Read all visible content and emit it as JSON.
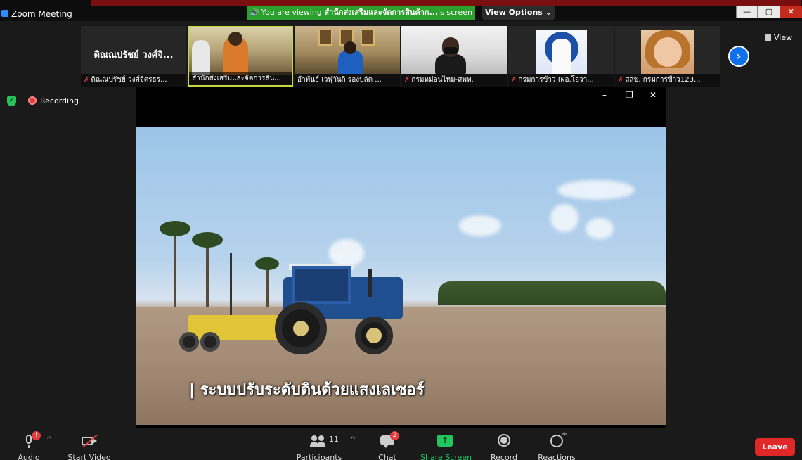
{
  "window": {
    "title": "Zoom Meeting",
    "controls": {
      "minimize": "—",
      "maximize": "▢",
      "close": "✕"
    }
  },
  "banner": {
    "prefix": "You are viewing",
    "presenter": "สำนักส่งเสริมและจัดการสินค้าก...",
    "suffix": "'s screen",
    "view_options": "View Options ⌄",
    "color": "#2ca02c"
  },
  "participants": [
    {
      "name": "ติณณปรัชย์ วงศ์จิตรธร...",
      "center_name": "ติณณปรัชย์ วงศ์จิ...",
      "muted": true,
      "video": false,
      "active": false
    },
    {
      "name": "สำนักส่งเสริมและจัดการสิน...",
      "muted": false,
      "video": true,
      "active": true
    },
    {
      "name": "อำพันธ์ เวฬุวันกิ รองปลัด ...",
      "muted": false,
      "video": true,
      "active": false
    },
    {
      "name": "กรมหม่อนไหม-สพท.",
      "muted": true,
      "video": true,
      "active": false
    },
    {
      "name": "กรมการข้าว (ผอ.โอวา...",
      "muted": true,
      "video": true,
      "active": false
    },
    {
      "name": "สสข. กรมการข้าว123...",
      "muted": true,
      "video": true,
      "active": false
    }
  ],
  "strip_controls": {
    "next_arrow": "›",
    "view_label": "View"
  },
  "recording": {
    "label": "Recording",
    "shield": "✓"
  },
  "share_controls": {
    "minimize": "–",
    "restore": "❐",
    "close": "✕"
  },
  "video": {
    "caption": "ระบบปรับระดับดินด้วยแสงเลเซอร์"
  },
  "toolbar": {
    "audio": {
      "label": "Audio",
      "badge": "!"
    },
    "video": {
      "label": "Start Video"
    },
    "participants": {
      "label": "Participants",
      "count": "11"
    },
    "chat": {
      "label": "Chat",
      "badge": "2"
    },
    "share": {
      "label": "Share Screen",
      "arrow": "↑"
    },
    "record": {
      "label": "Record"
    },
    "reactions": {
      "label": "Reactions",
      "plus": "+"
    },
    "leave": {
      "label": "Leave"
    },
    "caret": "^"
  },
  "colors": {
    "accent_green": "#22c55e",
    "accent_blue": "#0e71eb",
    "danger_red": "#e02828",
    "active_border": "#c4d93a"
  }
}
